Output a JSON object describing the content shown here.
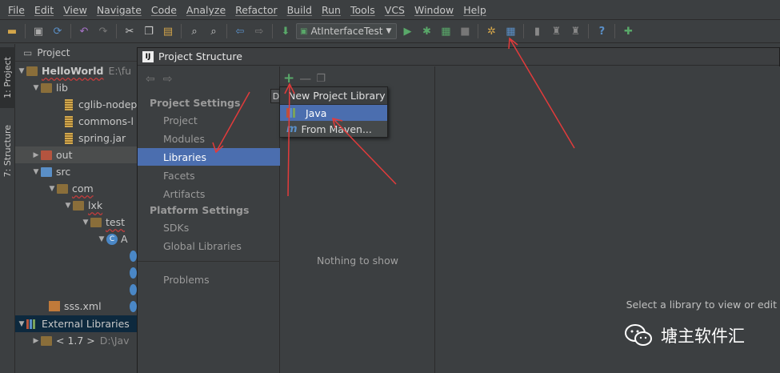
{
  "menu": [
    "File",
    "Edit",
    "View",
    "Navigate",
    "Code",
    "Analyze",
    "Refactor",
    "Build",
    "Run",
    "Tools",
    "VCS",
    "Window",
    "Help"
  ],
  "toolbar": {
    "run_config": "AtInterfaceTest"
  },
  "left_tabs": {
    "project": "1: Project",
    "structure": "7: Structure"
  },
  "project_panel": {
    "header": "Project",
    "tree": [
      {
        "label": "HelloWorld",
        "path": "E:\\fu",
        "depth": 0
      },
      {
        "label": "lib",
        "depth": 1
      },
      {
        "label": "cglib-nodep",
        "depth": 2
      },
      {
        "label": "commons-l",
        "depth": 2
      },
      {
        "label": "spring.jar",
        "depth": 2
      },
      {
        "label": "out",
        "depth": 1
      },
      {
        "label": "src",
        "depth": 1
      },
      {
        "label": "com",
        "depth": 2
      },
      {
        "label": "lxk",
        "depth": 3
      },
      {
        "label": "test",
        "depth": 4
      },
      {
        "label": "A",
        "depth": 5
      },
      {
        "label": "sss.xml",
        "depth": 1
      },
      {
        "label": "External Libraries",
        "depth": 0
      },
      {
        "label": "< 1.7 >",
        "path": "D:\\Jav",
        "depth": 1
      }
    ]
  },
  "dialog": {
    "title": "Project Structure",
    "sections": {
      "project_settings": "Project Settings",
      "platform_settings": "Platform Settings"
    },
    "items": {
      "project": "Project",
      "modules": "Modules",
      "libraries": "Libraries",
      "facets": "Facets",
      "artifacts": "Artifacts",
      "sdks": "SDKs",
      "global_libraries": "Global Libraries",
      "problems": "Problems"
    },
    "empty_text": "Nothing to show",
    "right_hint": "Select a library to view or edit",
    "tooltip_char": "D"
  },
  "popup": {
    "title": "New Project Library",
    "items": [
      "Java",
      "From Maven..."
    ]
  },
  "watermark": "塘主软件汇",
  "colors": {
    "selection": "#4b6eaf",
    "annotation_arrow": "#e23b3b",
    "background": "#3c3f41"
  }
}
